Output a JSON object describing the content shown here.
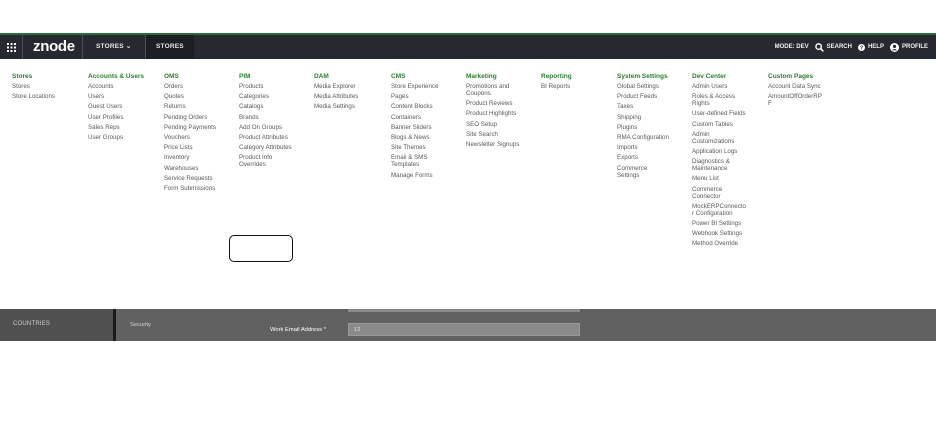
{
  "header": {
    "logo": "znode",
    "nav": [
      "STORES ⌄",
      "STORES"
    ],
    "tools": {
      "mode": "MODE: DEV",
      "search": "SEARCH",
      "help": "HELP",
      "profile": "PROFILE"
    }
  },
  "menu": {
    "columns": [
      {
        "title": "Stores",
        "items": [
          "Stores",
          "Store Locations"
        ]
      },
      {
        "title": "Accounts & Users",
        "items": [
          "Accounts",
          "Users",
          "Guest Users",
          "User Profiles",
          "Sales Reps",
          "User Groups"
        ]
      },
      {
        "title": "OMS",
        "items": [
          "Orders",
          "Quotes",
          "Returns",
          "Pending Orders",
          "Pending Payments",
          "Vouchers",
          "Price Lists",
          "Inventory",
          "Warehouses",
          "Service Requests",
          "Form Submissions"
        ]
      },
      {
        "title": "PIM",
        "items": [
          "Products",
          "Categories",
          "Catalogs",
          "Brands",
          "Add On Groups",
          "Product Attributes",
          "Category Attributes",
          "Product Info\nOverrides"
        ]
      },
      {
        "title": "DAM",
        "items": [
          "Media Explorer",
          "Media Attributes",
          "Media Settings"
        ]
      },
      {
        "title": "CMS",
        "items": [
          "Store Experience",
          "Pages",
          "Content Blocks",
          "Containers",
          "Banner Sliders",
          "Blogs & News",
          "Site Themes",
          "Email & SMS\nTemplates",
          "Manage Forms"
        ]
      },
      {
        "title": "Marketing",
        "items": [
          "Promotions and\nCoupons",
          "Product Reviews",
          "Product Highlights",
          "SEO Setup",
          "Site Search",
          "Newsletter Signups"
        ]
      },
      {
        "title": "Reporting",
        "items": [
          "BI Reports"
        ]
      },
      {
        "title": "System Settings",
        "items": [
          "Global Settings",
          "Product Feeds",
          "Taxes",
          "Shipping",
          "Plugins",
          "RMA Configuration",
          "Imports",
          "Exports",
          "Commerce\nSettings"
        ]
      },
      {
        "title": "Dev Center",
        "items": [
          "Admin Users",
          "Roles & Access\nRights",
          "User-defined Fields",
          "Custom Tables",
          "Admin\nCustomizations",
          "Application Logs",
          "Diagnostics &\nMaintenance",
          "Menu List",
          "Commerce\nConnector",
          "MockERPConnecto\nr Configuration",
          "Power BI Settings",
          "Webhook Settings",
          "Method Override"
        ]
      },
      {
        "title": "Custom Pages",
        "items": [
          "Account Data Sync",
          "AmountOffOrderRP\nF"
        ]
      }
    ]
  },
  "underlay": {
    "countries": "COUNTRIES",
    "security": "Security",
    "email_label": "Work Email Address *",
    "email_value": "12"
  },
  "colors": {
    "topbar": "#262a30",
    "accent": "#2e7d32",
    "menu_text": "#5a5a5a"
  }
}
